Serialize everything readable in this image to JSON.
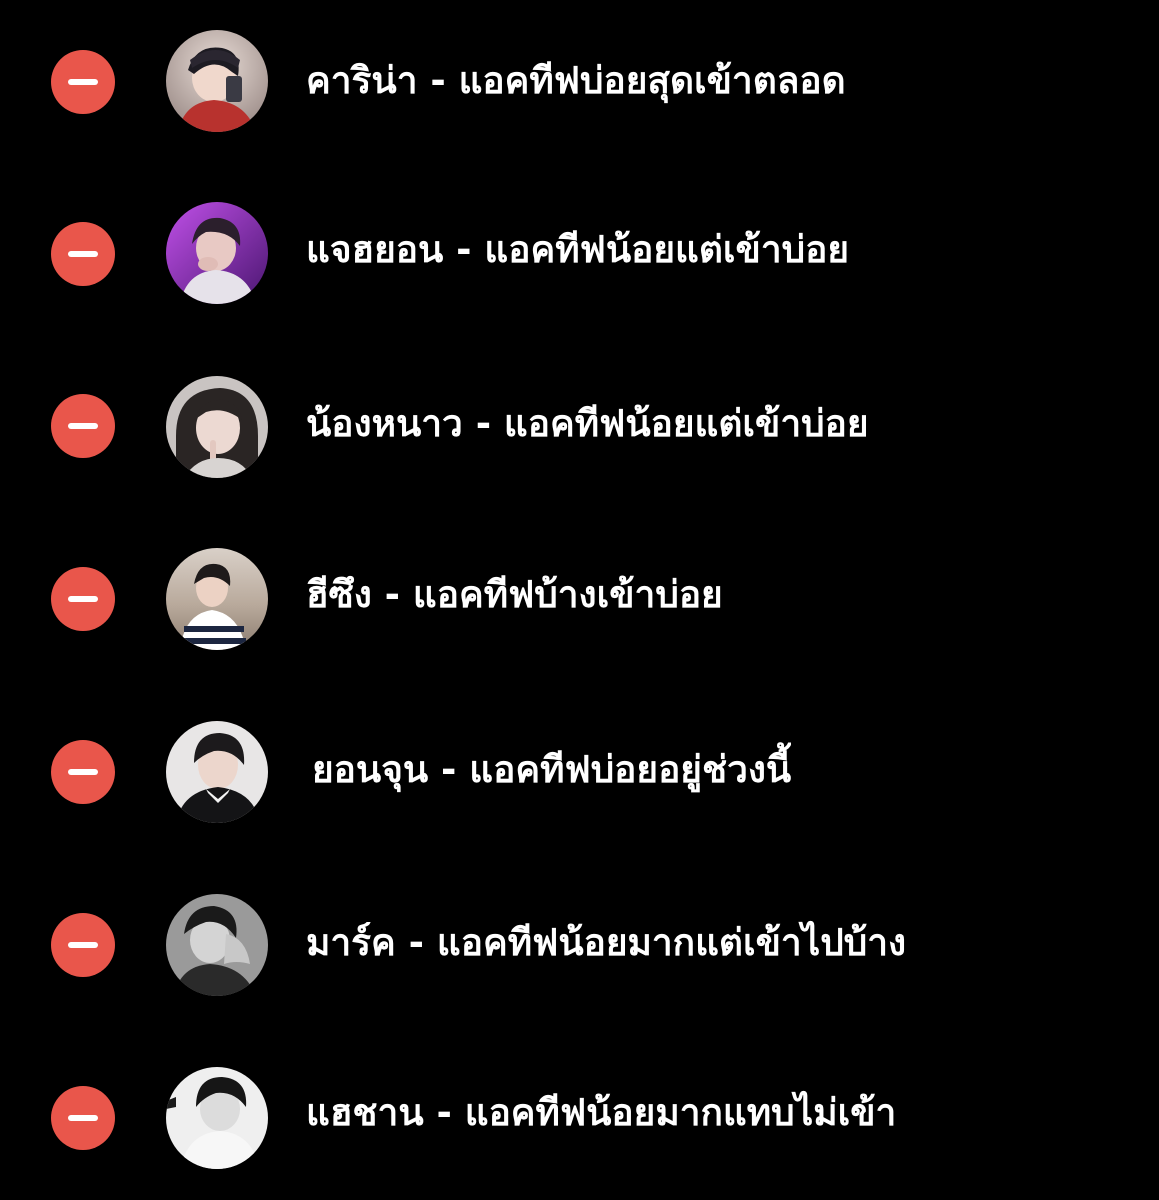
{
  "accent_color": "#e9564b",
  "background_color": "#000000",
  "remove_icon": "minus-icon",
  "rows": [
    {
      "label": "คาริน่า - แอคทีฟบ่อยสุดเข้าตลอด",
      "avatar_icon": "profile-photo-icon"
    },
    {
      "label": "แจฮยอน - แอคทีฟน้อยแต่เข้าบ่อย",
      "avatar_icon": "profile-photo-icon"
    },
    {
      "label": "น้องหนาว - แอคทีฟน้อยแต่เข้าบ่อย",
      "avatar_icon": "profile-photo-icon"
    },
    {
      "label": "ฮีซึง - แอคทีฟบ้างเข้าบ่อย",
      "avatar_icon": "profile-photo-icon"
    },
    {
      "label": "ยอนจุน - แอคทีฟบ่อยอยู่ช่วงนี้",
      "avatar_icon": "profile-photo-icon"
    },
    {
      "label": "มาร์ค - แอคทีฟน้อยมากแต่เข้าไปบ้าง",
      "avatar_icon": "profile-photo-icon"
    },
    {
      "label": "แฮชาน - แอคทีฟน้อยมากแทบไม่เข้า",
      "avatar_icon": "profile-photo-icon"
    }
  ]
}
